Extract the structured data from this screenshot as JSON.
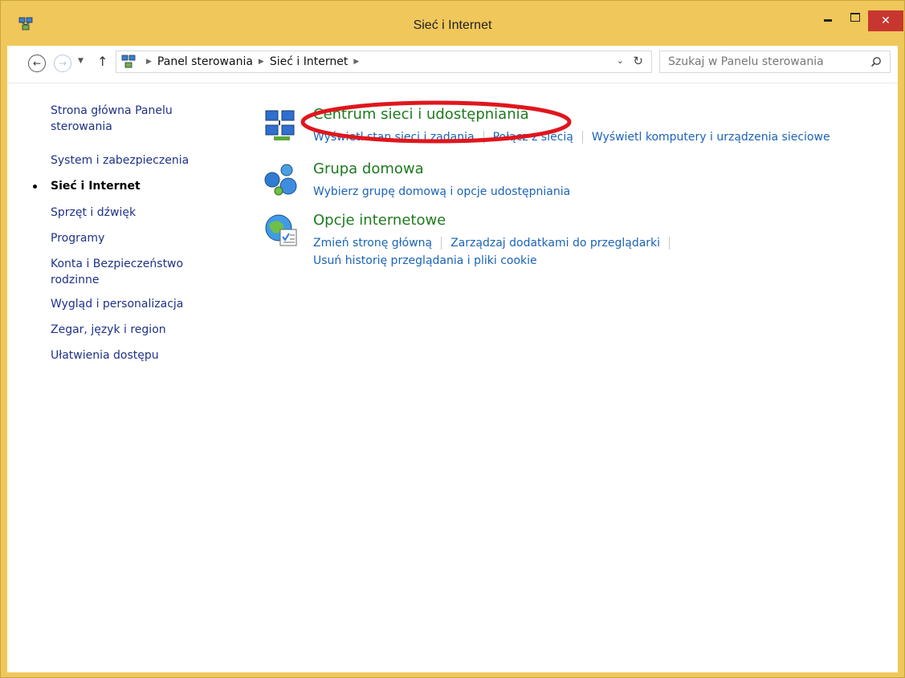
{
  "window": {
    "title": "Sieć i Internet",
    "close_label": "✕"
  },
  "toolbar": {
    "breadcrumb": [
      "Panel sterowania",
      "Sieć i Internet"
    ],
    "search_placeholder": "Szukaj w Panelu sterowania"
  },
  "sidebar": {
    "items": [
      {
        "label": "Strona główna Panelu sterowania",
        "active": false
      },
      {
        "label": "System i zabezpieczenia",
        "active": false
      },
      {
        "label": "Sieć i Internet",
        "active": true
      },
      {
        "label": "Sprzęt i dźwięk",
        "active": false
      },
      {
        "label": "Programy",
        "active": false
      },
      {
        "label": "Konta i Bezpieczeństwo rodzinne",
        "active": false
      },
      {
        "label": "Wygląd i personalizacja",
        "active": false
      },
      {
        "label": "Zegar, język i region",
        "active": false
      },
      {
        "label": "Ułatwienia dostępu",
        "active": false
      }
    ]
  },
  "categories": [
    {
      "title": "Centrum sieci i udostępniania",
      "icon": "network-center-icon",
      "links": [
        "Wyświetl stan sieci i zadania",
        "Połącz z siecią",
        "Wyświetl komputery i urządzenia sieciowe"
      ]
    },
    {
      "title": "Grupa domowa",
      "icon": "homegroup-icon",
      "links": [
        "Wybierz grupę domową i opcje udostępniania"
      ]
    },
    {
      "title": "Opcje internetowe",
      "icon": "internet-options-icon",
      "links": [
        "Zmień stronę główną",
        "Zarządzaj dodatkami do przeglądarki"
      ],
      "links2": [
        "Usuń historię przeglądania i pliki cookie"
      ]
    }
  ],
  "colors": {
    "titlebar": "#f0c75a",
    "link": "#1a63b8",
    "category_title": "#1e7a1e",
    "annotation": "#e0161d"
  }
}
